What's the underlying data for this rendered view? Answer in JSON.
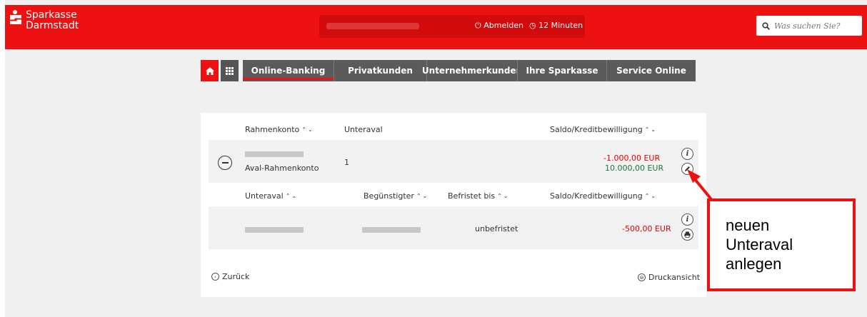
{
  "header": {
    "logo_line1": "Sparkasse",
    "logo_line2": "Darmstadt",
    "logout_label": "Abmelden",
    "timer_label": "12 Minuten",
    "search_placeholder": "Was suchen Sie?",
    "accent_color": "#ee1111"
  },
  "nav": {
    "items": [
      {
        "label": "Online-Banking"
      },
      {
        "label": "Privatkunden"
      },
      {
        "label": "Unternehmerkunden"
      },
      {
        "label": "Ihre Sparkasse"
      },
      {
        "label": "Service Online"
      }
    ]
  },
  "table1": {
    "col_rahmenkonto": "Rahmenkonto",
    "col_unteraval": "Unteraval",
    "col_saldo": "Saldo/Kreditbewilligung",
    "row": {
      "konto_name": "Aval-Rahmenkonto",
      "unteraval_count": "1",
      "saldo": "-1.000,00 EUR",
      "kreditbewilligung": "10.000,00 EUR"
    }
  },
  "table2": {
    "col_unteraval": "Unteraval",
    "col_beguenstigter": "Begünstigter",
    "col_befristet": "Befristet bis",
    "col_saldo": "Saldo/Kreditbewilligung",
    "row": {
      "befristet": "unbefristet",
      "saldo": "-500,00 EUR"
    }
  },
  "footer": {
    "back_label": "Zurück",
    "print_label": "Druckansicht"
  },
  "annotation": {
    "line1": "neuen",
    "line2": "Unteraval",
    "line3": "anlegen"
  }
}
